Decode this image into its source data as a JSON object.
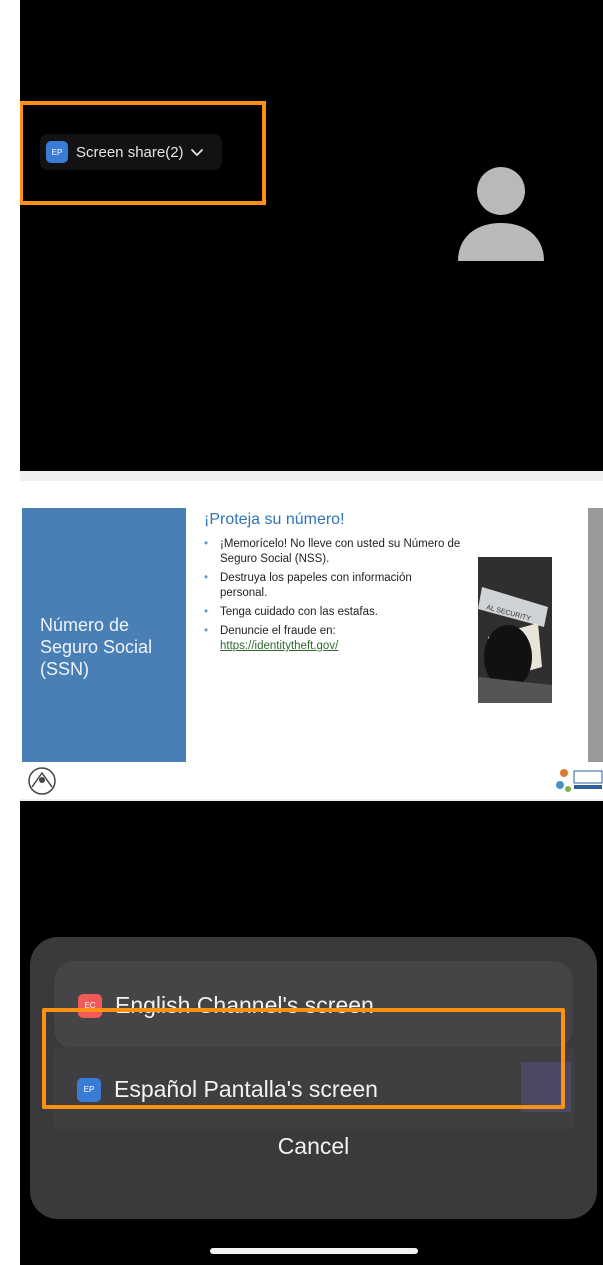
{
  "meeting": {
    "share_pill": {
      "badge": "EP",
      "label": "Screen share(2)"
    }
  },
  "slide": {
    "panel_title": "Número de Seguro Social (SSN)",
    "title": "¡Proteja su número!",
    "bullets": [
      "¡Memorícelo! No lleve con usted su Número de Seguro Social (NSS).",
      "Destruya los papeles con información personal.",
      "Tenga cuidado con las estafas.",
      "Denuncie el fraude en:"
    ],
    "link": "https://identitytheft.gov/",
    "photo_label": "AL SECURITY"
  },
  "share_menu": {
    "options": [
      {
        "badge": "EC",
        "label": "English Channel's screen",
        "badge_color": "#f25a5a"
      },
      {
        "badge": "EP",
        "label": "Español Pantalla's screen",
        "badge_color": "#3a7bd5"
      }
    ],
    "cancel": "Cancel"
  },
  "colors": {
    "highlight": "#ff9016",
    "slide_panel": "#4a7fb5"
  }
}
